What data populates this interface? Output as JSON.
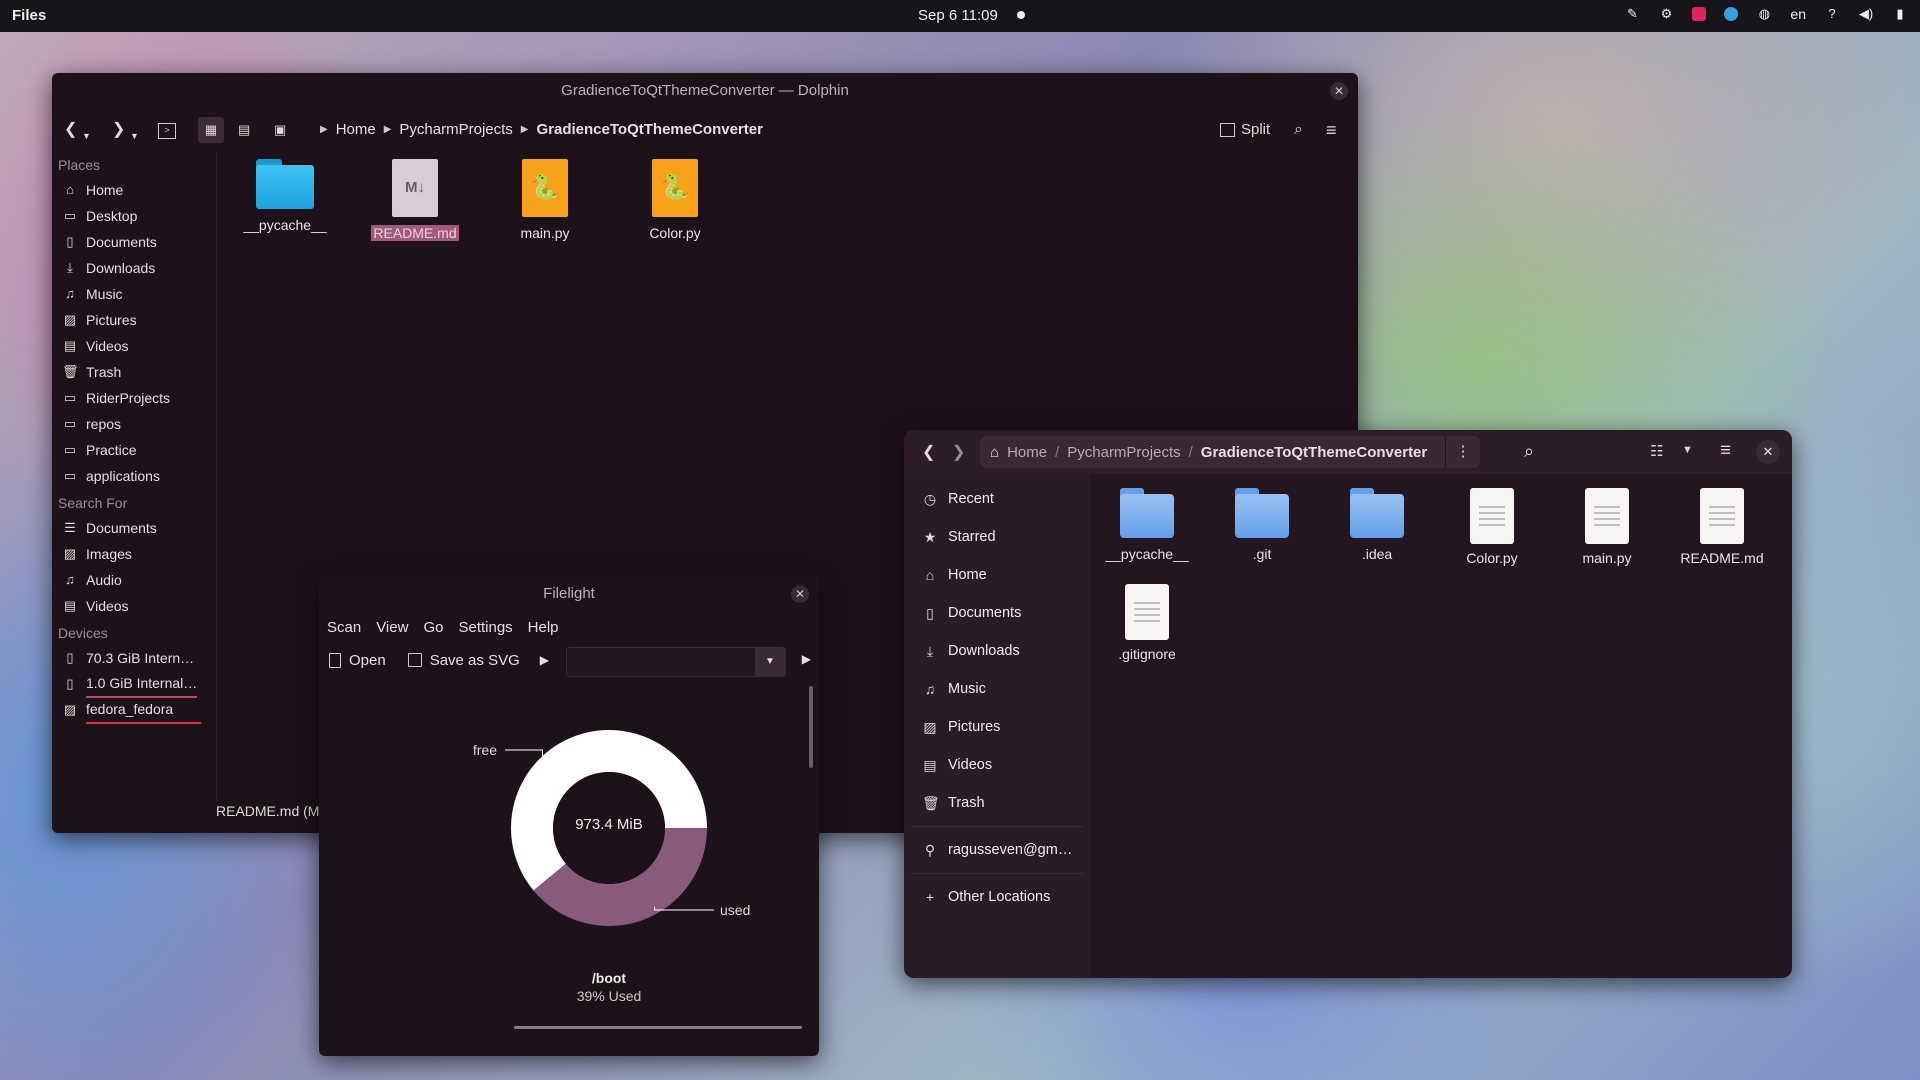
{
  "topbar": {
    "app_name": "Files",
    "clock": "Sep 6  11:09",
    "language": "en",
    "tray_icons": [
      "pipette-icon",
      "settings-icon",
      "jetbrains-icon",
      "edge-icon",
      "gamepad-icon",
      "help-icon",
      "volume-icon",
      "battery-icon"
    ]
  },
  "dolphin": {
    "title": "GradienceToQtThemeConverter — Dolphin",
    "breadcrumbs": [
      "Home",
      "PycharmProjects",
      "GradienceToQtThemeConverter"
    ],
    "split_label": "Split",
    "sidebar": {
      "places_header": "Places",
      "places": [
        "Home",
        "Desktop",
        "Documents",
        "Downloads",
        "Music",
        "Pictures",
        "Videos",
        "Trash",
        "RiderProjects",
        "repos",
        "Practice",
        "applications"
      ],
      "search_header": "Search For",
      "search": [
        "Documents",
        "Images",
        "Audio",
        "Videos"
      ],
      "devices_header": "Devices",
      "devices": [
        "70.3 GiB Intern…",
        "1.0 GiB Internal…",
        "fedora_fedora"
      ]
    },
    "files": [
      {
        "name": "__pycache__",
        "kind": "folder"
      },
      {
        "name": "README.md",
        "kind": "markdown",
        "selected": true
      },
      {
        "name": "main.py",
        "kind": "python"
      },
      {
        "name": "Color.py",
        "kind": "python"
      }
    ],
    "status": "README.md (M"
  },
  "filelight": {
    "title": "Filelight",
    "menu": [
      "Scan",
      "View",
      "Go",
      "Settings",
      "Help"
    ],
    "open_label": "Open",
    "save_svg_label": "Save as SVG",
    "center_label": "973.4 MiB",
    "free_label": "free",
    "used_label": "used",
    "path_label": "/boot",
    "usage_label": "39% Used",
    "used_fraction": 0.39,
    "colors": {
      "free": "#ffffff",
      "used": "#8a5a7c",
      "hole": "#1d111a"
    }
  },
  "nautilus": {
    "breadcrumbs": [
      "Home",
      "PycharmProjects",
      "GradienceToQtThemeConverter"
    ],
    "sidebar": [
      "Recent",
      "Starred",
      "Home",
      "Documents",
      "Downloads",
      "Music",
      "Pictures",
      "Videos",
      "Trash"
    ],
    "account": "ragusseven@gm…",
    "other_locations": "Other Locations",
    "files": [
      {
        "name": "__pycache__",
        "kind": "folder"
      },
      {
        "name": ".git",
        "kind": "folder"
      },
      {
        "name": ".idea",
        "kind": "folder"
      },
      {
        "name": "Color.py",
        "kind": "doc"
      },
      {
        "name": "main.py",
        "kind": "doc"
      },
      {
        "name": "README.md",
        "kind": "doc"
      },
      {
        "name": ".gitignore",
        "kind": "doc"
      }
    ]
  }
}
